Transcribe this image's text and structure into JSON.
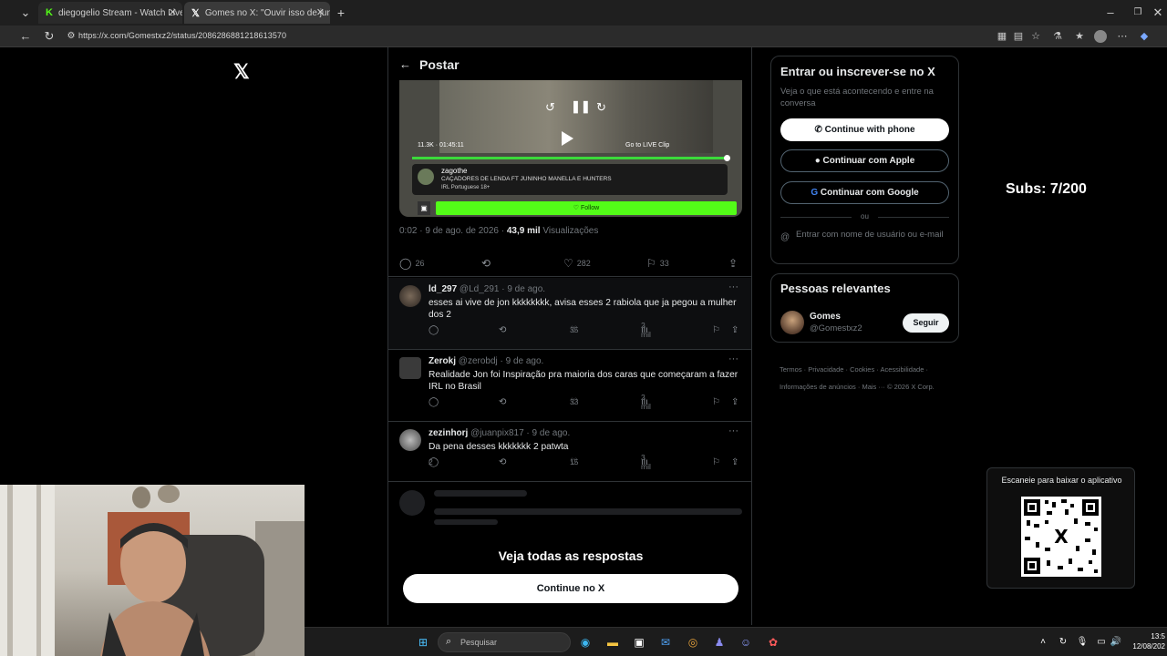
{
  "browser": {
    "tabs": [
      {
        "title": "diegogelio Stream - Watch Live on",
        "favicon": "K"
      },
      {
        "title": "Gomes no X: \"Ouvir isso de juninh",
        "favicon": "X"
      }
    ],
    "new_tab": "+",
    "url": "https://x.com/Gomestxz2/status/2086286881218613570"
  },
  "x_page": {
    "header_title": "Postar",
    "video": {
      "stats": "11.3K · 01:45:11",
      "golive": "Go to LIVE   Clip",
      "channel_name": "zagothe",
      "channel_sub": "CAÇADORES DE LENDA FT JUNINHO MANELLA E HUNTERS",
      "tags": "IRL   Portuguese   18+",
      "follow_label": "♡ Follow"
    },
    "meta": {
      "time": "0:02 · 9 de ago. de 2026 · ",
      "views_count": "43,9 mil",
      "views_label": " Visualizações"
    },
    "actions": {
      "replies": "26",
      "likes": "282",
      "bookmarks": "33"
    },
    "replies": [
      {
        "name": "ld_297",
        "handle": "@Ld_291 · 9 de ago.",
        "text": "esses ai vive de jon kkkkkkkk, avisa esses 2 rabiola que ja pegou a mulher dos 2",
        "replies": "",
        "likes": "35",
        "views": "2 mil"
      },
      {
        "name": "Zerokj",
        "handle": "@zerobdj · 9 de ago.",
        "text": "Realidade Jon foi Inspiração pra maioria dos caras que começaram a fazer IRL no Brasil",
        "replies": "",
        "likes": "33",
        "views": "2 mil"
      },
      {
        "name": "zezinhorj",
        "handle": "@juanpix817 · 9 de ago.",
        "text": "Da pena desses kkkkkkk  2 patwta",
        "replies": "2",
        "likes": "15",
        "views": "3 mil"
      }
    ],
    "see_all": "Veja todas as respostas",
    "continue_label": "Continue no X"
  },
  "sidebar": {
    "signup_title": "Entrar ou inscrever-se no X",
    "signup_desc": "Veja o que está acontecendo e entre na conversa",
    "phone_btn": "Continue with phone",
    "apple_btn": "Continuar com Apple",
    "google_btn": "Continuar com Google",
    "or": "ou",
    "email_prompt": "Entrar com nome de usuário ou e-mail",
    "relevant_title": "Pessoas relevantes",
    "relevant_name": "Gomes",
    "relevant_handle": "@Gomestxz2",
    "relevant_follow": "Seguir",
    "footer_line1": "Termos · Privacidade · Cookies · Acessibilidade ·",
    "footer_line2": "Informações de anúncios · Mais ··· © 2026 X Corp."
  },
  "overlay": {
    "subs": "Subs: 7/200",
    "qr_label": "Escaneie para baixar o aplicativo"
  },
  "taskbar": {
    "search_placeholder": "Pesquisar",
    "time": "13:5",
    "date": "12/08/202"
  },
  "colors": {
    "accent_green": "#53fc18",
    "bg": "#000000",
    "muted": "#71767b"
  }
}
